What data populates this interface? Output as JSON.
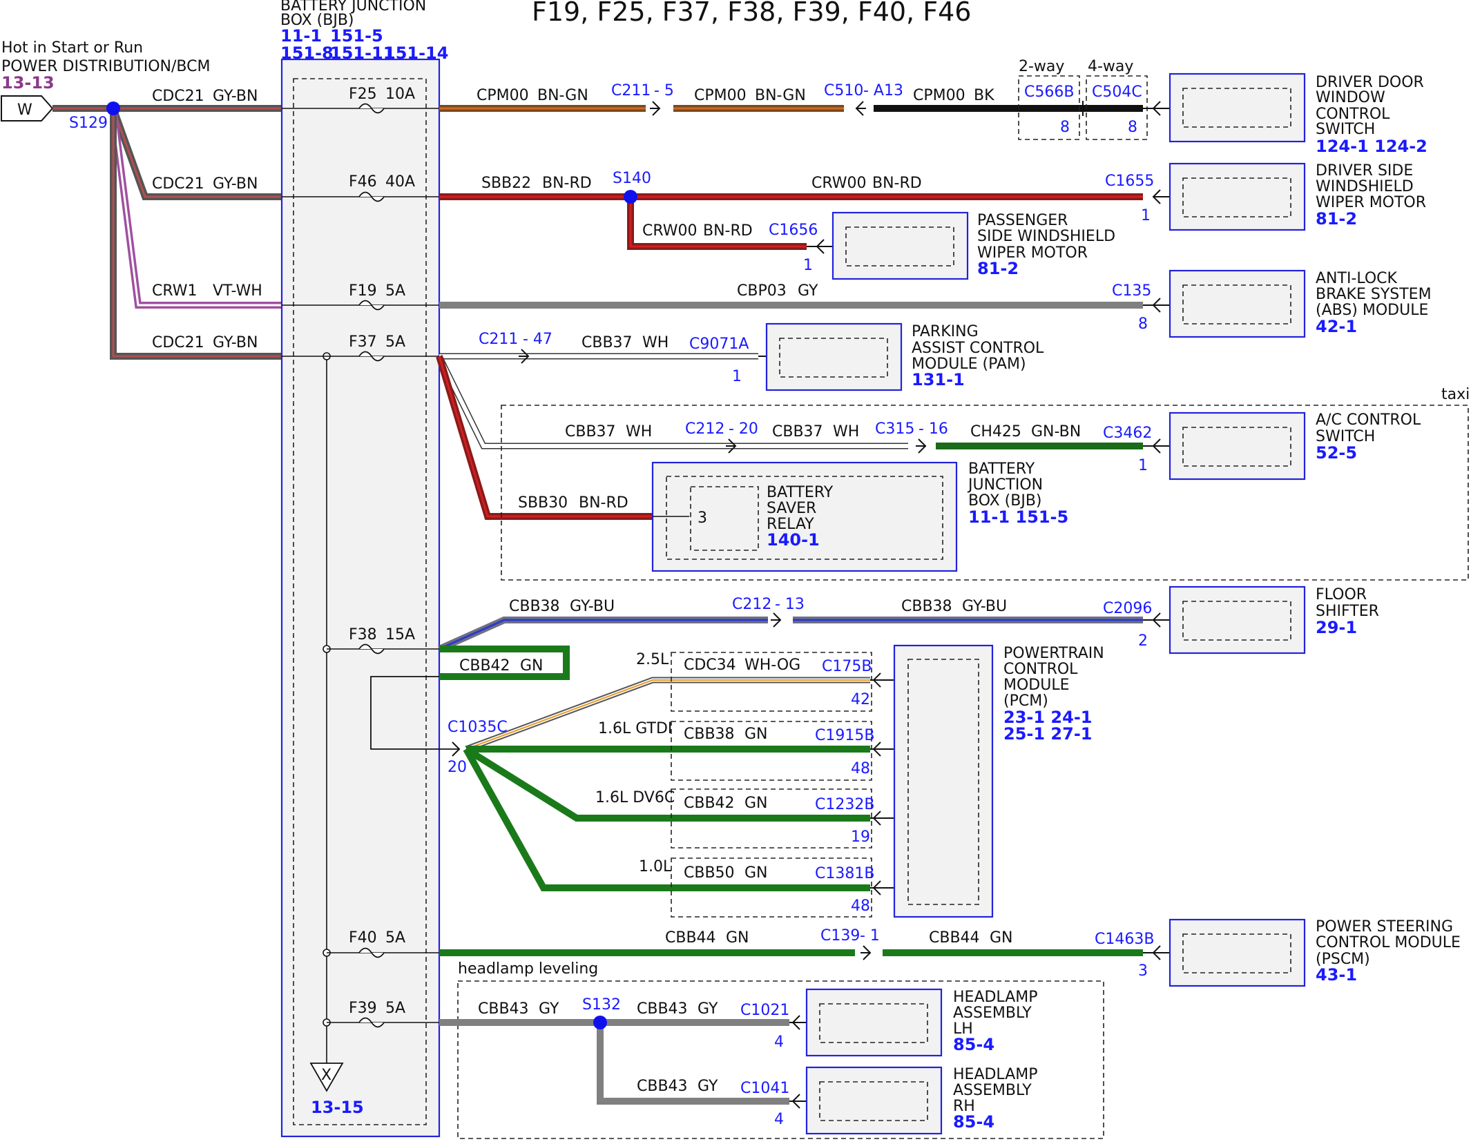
{
  "title": "F19, F25, F37, F38, F39, F40, F46",
  "source": {
    "hot_label": "Hot in Start or Run",
    "dist_label": "POWER DISTRIBUTION/BCM",
    "ref": "13-13",
    "connector_letter": "W",
    "splice": "S129"
  },
  "bjb": {
    "name_line1": "BATTERY JUNCTION",
    "name_line2": "BOX (BJB)",
    "refs_line1": [
      "11-1",
      "151-5"
    ],
    "refs_line2": [
      "151-8",
      "151-11",
      "151-14"
    ],
    "ground_letter": "X",
    "ground_ref": "13-15"
  },
  "fuses": [
    {
      "id": "F25",
      "rating": "10A"
    },
    {
      "id": "F46",
      "rating": "40A"
    },
    {
      "id": "F19",
      "rating": "5A"
    },
    {
      "id": "F37",
      "rating": "5A"
    },
    {
      "id": "F38",
      "rating": "15A"
    },
    {
      "id": "F40",
      "rating": "5A"
    },
    {
      "id": "F39",
      "rating": "5A"
    }
  ],
  "feed_wires": [
    {
      "circuit": "CDC21",
      "color": "GY-BN"
    },
    {
      "circuit": "CDC21",
      "color": "GY-BN"
    },
    {
      "circuit": "CRW1",
      "color": "VT-WH"
    },
    {
      "circuit": "CDC21",
      "color": "GY-BN"
    }
  ],
  "wires": {
    "cpm1": {
      "circuit": "CPM00",
      "color": "BN-GN"
    },
    "cpm2": {
      "circuit": "CPM00",
      "color": "BN-GN"
    },
    "cpm3": {
      "circuit": "CPM00",
      "color": "BK"
    },
    "sbb22": {
      "circuit": "SBB22",
      "color": "BN-RD"
    },
    "crw00a": {
      "circuit": "CRW00",
      "color": "BN-RD"
    },
    "crw00b": {
      "circuit": "CRW00",
      "color": "BN-RD"
    },
    "cbp03": {
      "circuit": "CBP03",
      "color": "GY"
    },
    "cbb37a": {
      "circuit": "CBB37",
      "color": "WH"
    },
    "cbb37b": {
      "circuit": "CBB37",
      "color": "WH"
    },
    "cbb37c": {
      "circuit": "CBB37",
      "color": "WH"
    },
    "ch425": {
      "circuit": "CH425",
      "color": "GN-BN"
    },
    "sbb30": {
      "circuit": "SBB30",
      "color": "BN-RD"
    },
    "cbb38a": {
      "circuit": "CBB38",
      "color": "GY-BU"
    },
    "cbb38b": {
      "circuit": "CBB38",
      "color": "GY-BU"
    },
    "cbb42loop": {
      "circuit": "CBB42",
      "color": "GN"
    },
    "cdc34": {
      "circuit": "CDC34",
      "color": "WH-OG"
    },
    "cbb38gn": {
      "circuit": "CBB38",
      "color": "GN"
    },
    "cbb42gn": {
      "circuit": "CBB42",
      "color": "GN"
    },
    "cbb50": {
      "circuit": "CBB50",
      "color": "GN"
    },
    "cbb44a": {
      "circuit": "CBB44",
      "color": "GN"
    },
    "cbb44b": {
      "circuit": "CBB44",
      "color": "GN"
    },
    "cbb43a": {
      "circuit": "CBB43",
      "color": "GY"
    },
    "cbb43b": {
      "circuit": "CBB43",
      "color": "GY"
    },
    "cbb43c": {
      "circuit": "CBB43",
      "color": "GY"
    }
  },
  "connectors": {
    "c211_5": "C211",
    "c211_5_pin": "- 5",
    "c510": "C510",
    "c510_pin": "- A13",
    "c566b": "C566B",
    "c566b_pin": "8",
    "c504c": "C504C",
    "c504c_pin": "8",
    "two_way": "2-way",
    "four_way": "4-way",
    "s140": "S140",
    "c1655": "C1655",
    "c1655_pin": "1",
    "c1656": "C1656",
    "c1656_pin": "1",
    "c135": "C135",
    "c135_pin": "8",
    "c211_47": "C211",
    "c211_47_pin": "- 47",
    "c9071a": "C9071A",
    "c9071a_pin": "1",
    "c212_20": "C212",
    "c212_20_pin": "- 20",
    "c315": "C315",
    "c315_pin": "- 16",
    "c3462": "C3462",
    "c3462_pin": "1",
    "relay_pin": "3",
    "c212_13": "C212",
    "c212_13_pin": "- 13",
    "c2096": "C2096",
    "c2096_pin": "2",
    "c1035c": "C1035C",
    "c1035c_pin": "20",
    "c175b": "C175B",
    "c175b_pin": "42",
    "c1915b": "C1915B",
    "c1915b_pin": "48",
    "c1232b": "C1232B",
    "c1232b_pin": "19",
    "c1381b": "C1381B",
    "c1381b_pin": "48",
    "c139": "C139",
    "c139_pin": "- 1",
    "c1463b": "C1463B",
    "c1463b_pin": "3",
    "s132": "S132",
    "c1021": "C1021",
    "c1021_pin": "4",
    "c1041": "C1041",
    "c1041_pin": "4"
  },
  "engine_labels": [
    "2.5L",
    "1.6L GTDI",
    "1.6L DV6C",
    "1.0L"
  ],
  "groups": {
    "taxi": "taxi",
    "headlamp": "headlamp leveling"
  },
  "modules": {
    "door": {
      "lines": [
        "DRIVER DOOR",
        "WINDOW",
        "CONTROL",
        "SWITCH"
      ],
      "refs": "124-1 124-2"
    },
    "wiper_driver": {
      "lines": [
        "DRIVER SIDE",
        "WINDSHIELD",
        "WIPER MOTOR"
      ],
      "refs": "81-2"
    },
    "wiper_pass": {
      "lines": [
        "PASSENGER",
        "SIDE WINDSHIELD",
        "WIPER MOTOR"
      ],
      "refs": "81-2"
    },
    "abs": {
      "lines": [
        "ANTI-LOCK",
        "BRAKE SYSTEM",
        "(ABS) MODULE"
      ],
      "refs": "42-1"
    },
    "pam": {
      "lines": [
        "PARKING",
        "ASSIST CONTROL",
        "MODULE (PAM)"
      ],
      "refs": "131-1"
    },
    "ac": {
      "lines": [
        "A/C CONTROL",
        "SWITCH"
      ],
      "refs": "52-5"
    },
    "bjb_relay": {
      "lines": [
        "BATTERY",
        "JUNCTION",
        "BOX (BJB)"
      ],
      "refs": "11-1   151-5"
    },
    "relay": {
      "lines": [
        "BATTERY",
        "SAVER",
        "RELAY"
      ],
      "refs": "140-1"
    },
    "shifter": {
      "lines": [
        "FLOOR",
        "SHIFTER"
      ],
      "refs": "29-1"
    },
    "pcm": {
      "lines": [
        "POWERTRAIN",
        "CONTROL",
        "MODULE",
        "(PCM)"
      ],
      "refs1": "23-1   24-1",
      "refs2": "25-1   27-1"
    },
    "pscm": {
      "lines": [
        "POWER STEERING",
        "CONTROL MODULE",
        "(PSCM)"
      ],
      "refs": "43-1"
    },
    "hl_lh": {
      "lines": [
        "HEADLAMP",
        "ASSEMBLY",
        "LH"
      ],
      "refs": "85-4"
    },
    "hl_rh": {
      "lines": [
        "HEADLAMP",
        "ASSEMBLY",
        "RH"
      ],
      "refs": "85-4"
    }
  }
}
